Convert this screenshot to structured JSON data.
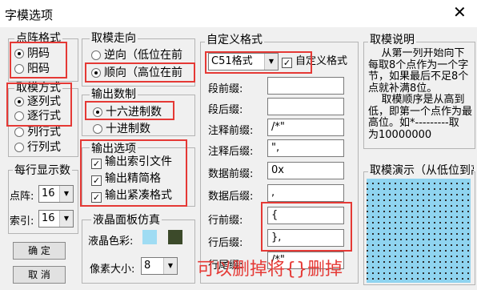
{
  "window": {
    "title": "字模选项",
    "close_glyph": "✕"
  },
  "dot_matrix": {
    "title": "点阵格式",
    "options": [
      "阴码",
      "阳码"
    ],
    "selected": 0
  },
  "mold_method": {
    "title": "取模方式",
    "options": [
      "逐列式",
      "逐行式",
      "列行式",
      "行列式"
    ],
    "selected": 0
  },
  "line_display": {
    "title": "每行显示数",
    "dot_label": "点阵:",
    "dot_value": "16",
    "index_label": "索引:",
    "index_value": "16"
  },
  "buttons": {
    "ok": "确    定",
    "cancel": "取    消"
  },
  "mold_direction": {
    "title": "取模走向",
    "options": [
      "逆向（低位在前",
      "顺向（高位在前"
    ],
    "selected": 1
  },
  "output_number": {
    "title": "输出数制",
    "options": [
      "十六进制数",
      "十进制数"
    ],
    "selected": 0
  },
  "output_options": {
    "title": "输出选项",
    "items": [
      "输出索引文件",
      "输出精简格",
      "输出紧凑格式"
    ],
    "checked": [
      true,
      true,
      true
    ]
  },
  "lcd": {
    "title": "液晶面板仿真",
    "color_label": "液晶色彩:",
    "color_light": "#9fdcf3",
    "color_dark": "#3c4a2a",
    "pixel_label": "像素大小:",
    "pixel_value": "8"
  },
  "custom_format": {
    "title": "自定义格式",
    "format_value": "C51格式",
    "custom_check_label": "自定义格式",
    "custom_checked": true,
    "fields": [
      {
        "label": "段前缀:",
        "value": ""
      },
      {
        "label": "段后缀:",
        "value": ""
      },
      {
        "label": "注释前缀:",
        "value": "/*\""
      },
      {
        "label": "注释后缀:",
        "value": "\","
      },
      {
        "label": "数据前缀:",
        "value": "0x"
      },
      {
        "label": "数据后缀:",
        "value": ","
      },
      {
        "label": "行前缀:",
        "value": "{"
      },
      {
        "label": "行后缀:",
        "value": "},"
      },
      {
        "label": "行尾缀:",
        "value": "/*\""
      }
    ]
  },
  "mold_help": {
    "title": "取模说明",
    "lines": [
      "    从第一列开始向下",
      "每取8个点作为一个字",
      "节，如果最后不足8个",
      "点就补满8位。",
      "    取模顺序是从高到",
      "低，即第一个点作为最",
      "高位。如*---------取",
      "为10000000"
    ]
  },
  "demo": {
    "title": "取模演示（从低位到高"
  },
  "annotation": "可以删掉将{}删掉",
  "accent_red": "#e53935"
}
